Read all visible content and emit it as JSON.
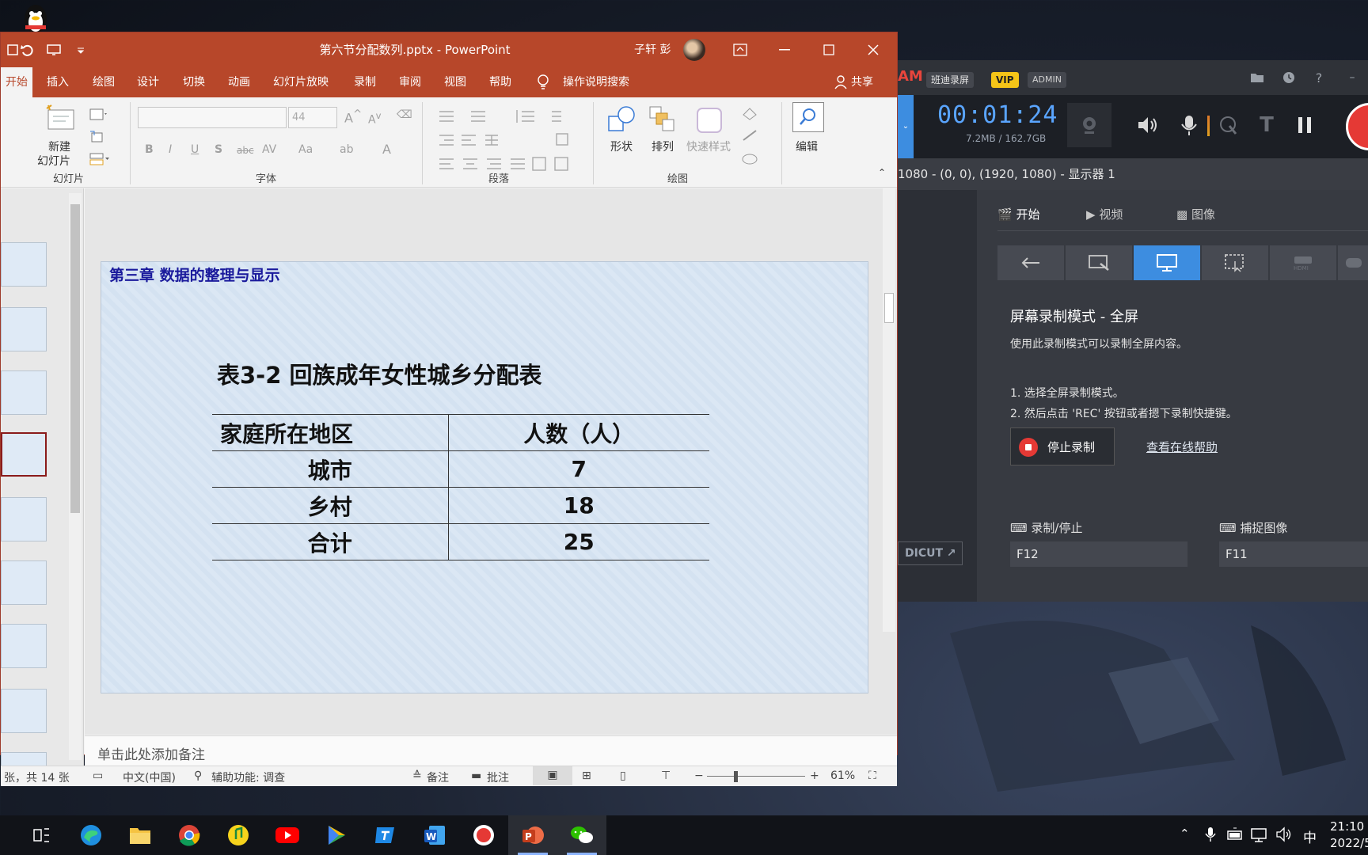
{
  "colors": {
    "ppt_accent": "#b7472a",
    "bandicam_accent": "#3d8de0",
    "rec_red": "#e53935"
  },
  "powerpoint": {
    "title": "第六节分配数列.pptx  -  PowerPoint",
    "user": "子轩 彭",
    "tabs": [
      "开始",
      "插入",
      "绘图",
      "设计",
      "切换",
      "动画",
      "幻灯片放映",
      "录制",
      "审阅",
      "视图",
      "帮助"
    ],
    "search": "操作说明搜索",
    "share": "共享",
    "ribbon": {
      "new_slide": [
        "新建",
        "幻灯片"
      ],
      "font_size": "44",
      "shape": "形状",
      "arrange": "排列",
      "quick_styles": "快速样式",
      "edit": "编辑",
      "groups": {
        "slides": "幻灯片",
        "font": "字体",
        "paragraph": "段落",
        "drawing": "绘图"
      }
    },
    "slide": {
      "chapter": "第三章  数据的整理与显示",
      "title": "表3-2    回族成年女性城乡分配表",
      "table": {
        "header": [
          "家庭所在地区",
          "人数（人）"
        ],
        "rows": [
          [
            "城市",
            "7"
          ],
          [
            "乡村",
            "18"
          ],
          [
            "合计",
            "25"
          ]
        ]
      }
    },
    "notes_placeholder": "单击此处添加备注",
    "status": {
      "slide_count": "张，共 14 张",
      "language": "中文(中国)",
      "accessibility": "辅助功能: 调查",
      "notes": "备注",
      "comments": "批注",
      "zoom": "61%"
    }
  },
  "bandicam": {
    "logo": "AM",
    "brand": "班迪录屏",
    "vip": "VIP",
    "admin": "ADMIN",
    "timer": "00:01:24",
    "size": "7.2MB / 162.7GB",
    "display_info": "1080 - (0, 0), (1920, 1080) - 显示器 1",
    "tabs": [
      "开始",
      "视频",
      "图像"
    ],
    "mode_title": "屏幕录制模式 - 全屏",
    "mode_desc": "使用此录制模式可以录制全屏内容。",
    "steps": [
      "1. 选择全屏录制模式。",
      "2. 然后点击 'REC' 按钮或者摁下录制快捷键。"
    ],
    "stop_button": "停止录制",
    "help_link": "查看在线帮助",
    "hotkeys": [
      {
        "label": "录制/停止",
        "value": "F12"
      },
      {
        "label": "捕捉图像",
        "value": "F11"
      }
    ],
    "bandicut": "DICUT"
  },
  "taskbar": {
    "ime": "中",
    "time": "21:10",
    "date": "2022/5"
  }
}
